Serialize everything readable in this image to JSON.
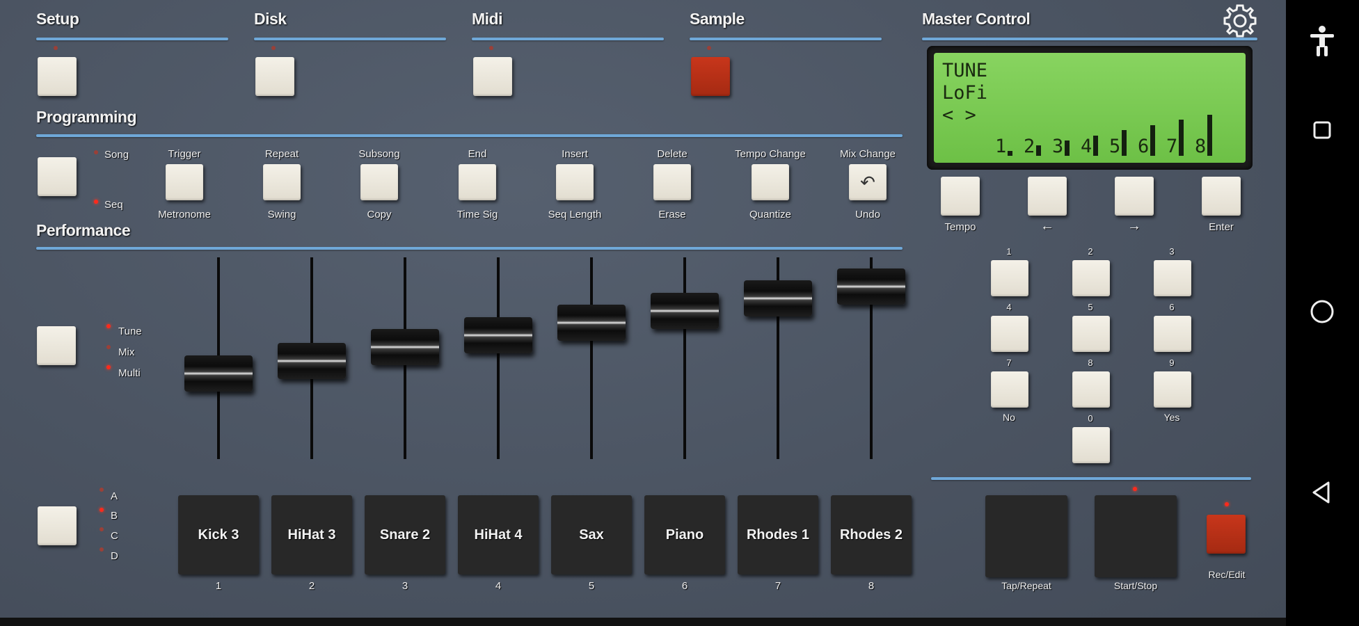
{
  "sections": {
    "setup": "Setup",
    "disk": "Disk",
    "midi": "Midi",
    "sample": "Sample",
    "master_control": "Master Control",
    "programming": "Programming",
    "performance": "Performance"
  },
  "programming": {
    "mode_labels": [
      "Song",
      "Seq"
    ],
    "functions": [
      {
        "top": "Trigger",
        "bottom": "Metronome"
      },
      {
        "top": "Repeat",
        "bottom": "Swing"
      },
      {
        "top": "Subsong",
        "bottom": "Copy"
      },
      {
        "top": "End",
        "bottom": "Time Sig"
      },
      {
        "top": "Insert",
        "bottom": "Seq Length"
      },
      {
        "top": "Delete",
        "bottom": "Erase"
      },
      {
        "top": "Tempo Change",
        "bottom": "Quantize"
      },
      {
        "top": "Mix Change",
        "bottom": "Undo"
      }
    ],
    "undo_icon": "↶"
  },
  "performance": {
    "mode_labels": [
      "Tune",
      "Mix",
      "Multi"
    ],
    "bank_labels": [
      "A",
      "B",
      "C",
      "D"
    ]
  },
  "lcd": {
    "line1": "TUNE",
    "line2": "LoFi",
    "line3": "< >",
    "channels": [
      "1",
      "2",
      "3",
      "4",
      "5",
      "6",
      "7",
      "8"
    ],
    "levels": [
      0.05,
      0.17,
      0.29,
      0.41,
      0.53,
      0.65,
      0.77,
      0.89
    ]
  },
  "master": {
    "nav_buttons": [
      "Tempo",
      "←",
      "→",
      "Enter"
    ],
    "keypad": [
      "1",
      "2",
      "3",
      "4",
      "5",
      "6",
      "7",
      "8",
      "9"
    ],
    "no_label": "No",
    "yes_label": "Yes",
    "zero_label": "0",
    "transport": [
      "Tap/Repeat",
      "Start/Stop",
      "Rec/Edit"
    ]
  },
  "faders": {
    "levels": [
      0.27,
      0.33,
      0.4,
      0.46,
      0.52,
      0.58,
      0.64,
      0.7
    ]
  },
  "pads": [
    {
      "label": "Kick 3",
      "number": "1"
    },
    {
      "label": "HiHat 3",
      "number": "2"
    },
    {
      "label": "Snare 2",
      "number": "3"
    },
    {
      "label": "HiHat 4",
      "number": "4"
    },
    {
      "label": "Sax",
      "number": "5"
    },
    {
      "label": "Piano",
      "number": "6"
    },
    {
      "label": "Rhodes 1",
      "number": "7"
    },
    {
      "label": "Rhodes 2",
      "number": "8"
    }
  ],
  "icons": {
    "settings": "gear-icon",
    "accessibility": "accessibility-icon",
    "recents": "square-icon",
    "home": "circle-icon",
    "back": "triangle-back-icon"
  },
  "colors": {
    "accent_line": "#6fa8d8",
    "button_face": "#f4f1e8",
    "record_red": "#c8361b",
    "lcd_green": "#7cc852"
  }
}
